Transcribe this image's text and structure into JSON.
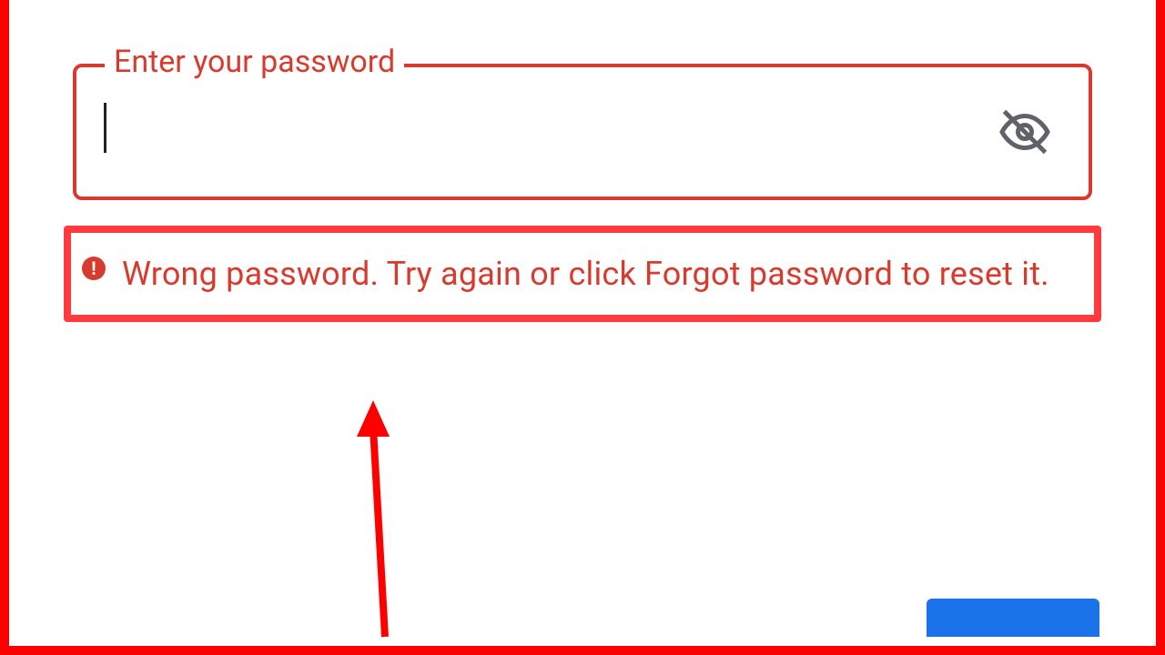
{
  "password_field": {
    "label": "Enter your password",
    "value": ""
  },
  "error": {
    "message": "Wrong password. Try again or click Forgot password to reset it."
  }
}
